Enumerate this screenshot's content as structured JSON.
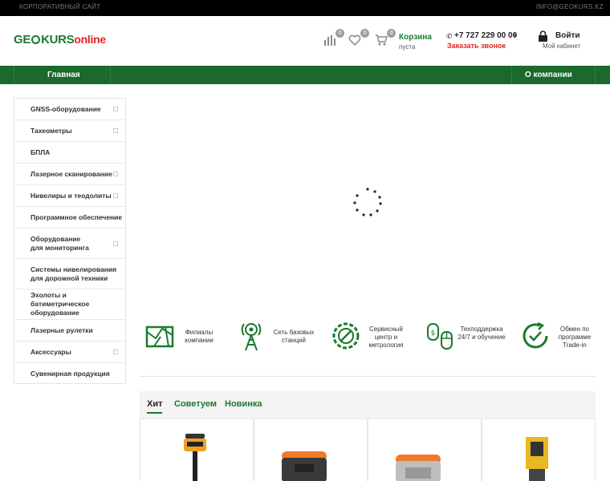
{
  "topbar": {
    "left_text": "КОРПОРАТИВНЫЙ САЙТ",
    "right_text": "INFO@GEOKURS.KZ"
  },
  "header": {
    "logo": {
      "part1": "GE",
      "part2": "KURS",
      "part3": "online"
    },
    "counters": {
      "compare": "0",
      "favorites": "0",
      "cart": "0"
    },
    "cart": {
      "title": "Корзина",
      "status": "пуста"
    },
    "phone": "+7 727 229 00 00",
    "callback": "Заказать звонок",
    "login": "Войти",
    "cabinet": "Мой кабинет",
    "icons": [
      "compare-icon",
      "heart-icon",
      "cart-icon",
      "phone-icon",
      "lock-icon"
    ]
  },
  "nav": {
    "items": [
      {
        "label": "Главная"
      },
      {
        "label": "О компании"
      }
    ]
  },
  "sidebar": {
    "items": [
      {
        "label": "GNSS-оборудование",
        "expandable": true
      },
      {
        "label": "Тахеометры",
        "expandable": true
      },
      {
        "label": "БПЛА",
        "expandable": false
      },
      {
        "label": "Лазерное сканирование",
        "expandable": true
      },
      {
        "label": "Нивелиры и теодолиты",
        "expandable": true
      },
      {
        "label": "Программное обеспечение",
        "expandable": false
      },
      {
        "label": "Оборудование для мониторинга",
        "expandable": true
      },
      {
        "label": "Системы нивелирования для дорожной техники",
        "expandable": false
      },
      {
        "label": "Эхолоты и батиметрическое оборудование",
        "expandable": false
      },
      {
        "label": "Лазерные рулетки",
        "expandable": false
      },
      {
        "label": "Аксессуары",
        "expandable": true
      },
      {
        "label": "Сувенирная продукция",
        "expandable": false
      }
    ]
  },
  "features": [
    {
      "label": "Филиалы компании",
      "icon": "map-icon"
    },
    {
      "label": "Сеть базовых станций",
      "icon": "antenna-icon"
    },
    {
      "label": "Сервисный центр и метрология",
      "icon": "service-icon"
    },
    {
      "label": "Техподдержка 24/7 и обучение",
      "icon": "support-icon"
    },
    {
      "label": "Обмен по программе Trade-in",
      "icon": "trade-in-icon"
    }
  ],
  "tabs": [
    {
      "label": "Хит",
      "active": true
    },
    {
      "label": "Советуем",
      "active": false
    },
    {
      "label": "Новинка",
      "active": false
    }
  ],
  "colors": {
    "brand_green": "#1a7a2e",
    "nav_green": "#1a6a2b",
    "accent_red": "#e0251c",
    "product_orange": "#f07a2a"
  }
}
